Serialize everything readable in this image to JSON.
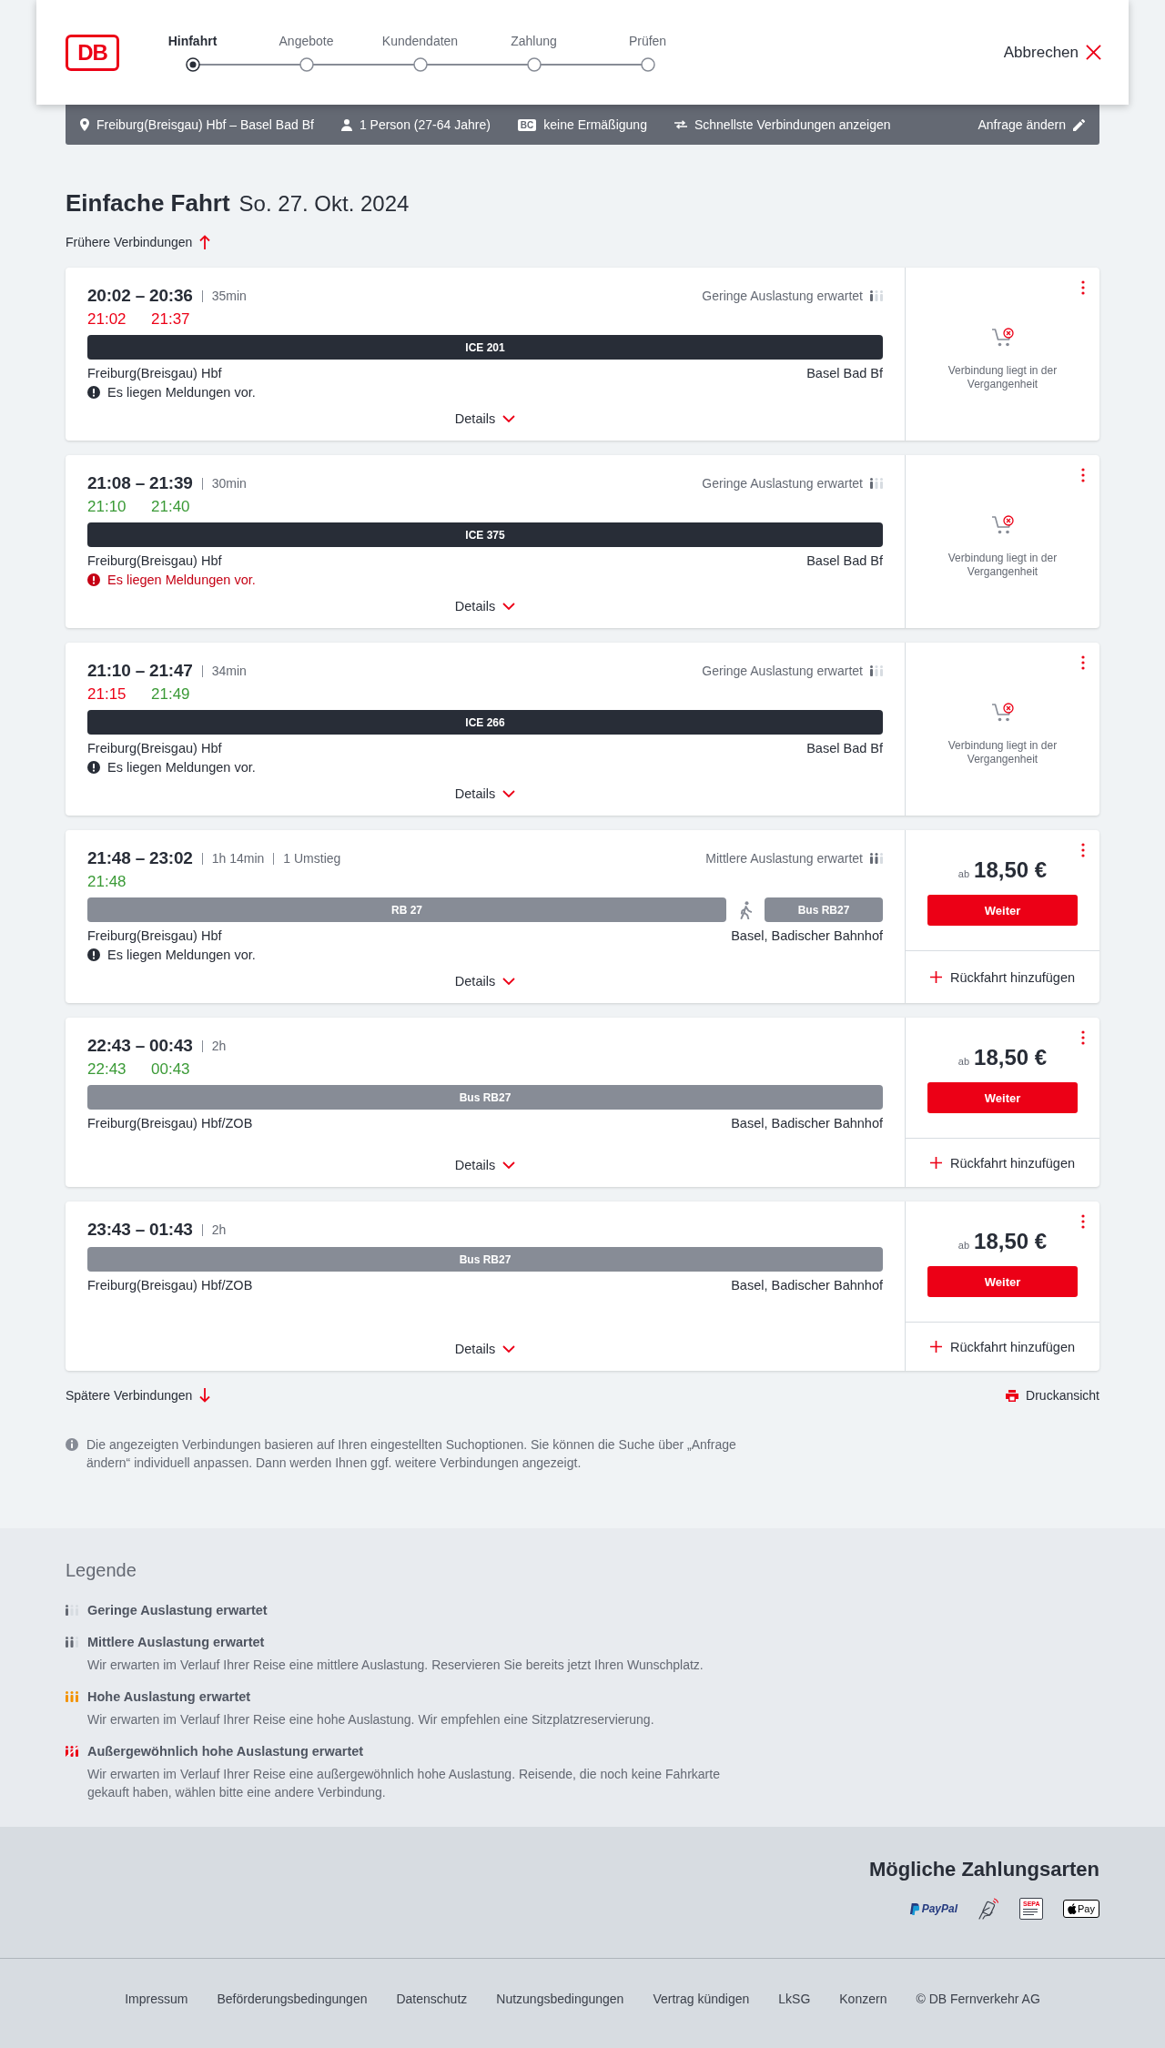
{
  "header": {
    "logo": "DB",
    "steps": [
      {
        "label": "Hinfahrt",
        "selected": true
      },
      {
        "label": "Angebote",
        "selected": false
      },
      {
        "label": "Kundendaten",
        "selected": false
      },
      {
        "label": "Zahlung",
        "selected": false
      },
      {
        "label": "Prüfen",
        "selected": false
      }
    ],
    "cancel": "Abbrechen"
  },
  "search_summary": {
    "route": "Freiburg(Breisgau) Hbf – Basel Bad Bf",
    "passengers": "1 Person (27-64 Jahre)",
    "discount_badge": "BC",
    "discount": "keine Ermäßigung",
    "option": "Schnellste Verbindungen anzeigen",
    "edit": "Anfrage ändern"
  },
  "heading": {
    "trip_type": "Einfache Fahrt",
    "date": "So. 27. Okt. 2024"
  },
  "earlier": "Frühere Verbindungen",
  "connections": [
    {
      "times": "20:02 – 20:36",
      "duration": "35min",
      "realtime": [
        {
          "time": "21:02",
          "on_time": false
        },
        {
          "time": "21:37",
          "on_time": false
        }
      ],
      "occupancy": {
        "kind": "low",
        "label": "Geringe Auslastung erwartet"
      },
      "segments": [
        {
          "kind": "ice",
          "label": "ICE 201"
        }
      ],
      "from": "Freiburg(Breisgau) Hbf",
      "to": "Basel Bad Bf",
      "message": {
        "text": "Es liegen Meldungen vor.",
        "critical": false
      },
      "details": "Details",
      "offer": {
        "kind": "past",
        "text": "Verbindung liegt in der Vergangenheit"
      }
    },
    {
      "times": "21:08 – 21:39",
      "duration": "30min",
      "realtime": [
        {
          "time": "21:10",
          "on_time": true
        },
        {
          "time": "21:40",
          "on_time": true
        }
      ],
      "occupancy": {
        "kind": "low",
        "label": "Geringe Auslastung erwartet"
      },
      "segments": [
        {
          "kind": "ice",
          "label": "ICE 375"
        }
      ],
      "from": "Freiburg(Breisgau) Hbf",
      "to": "Basel Bad Bf",
      "message": {
        "text": "Es liegen Meldungen vor.",
        "critical": true
      },
      "details": "Details",
      "offer": {
        "kind": "past",
        "text": "Verbindung liegt in der Vergangenheit"
      }
    },
    {
      "times": "21:10 – 21:47",
      "duration": "34min",
      "realtime": [
        {
          "time": "21:15",
          "on_time": false
        },
        {
          "time": "21:49",
          "on_time": true
        }
      ],
      "occupancy": {
        "kind": "low",
        "label": "Geringe Auslastung erwartet"
      },
      "segments": [
        {
          "kind": "ice",
          "label": "ICE 266"
        }
      ],
      "from": "Freiburg(Breisgau) Hbf",
      "to": "Basel Bad Bf",
      "message": {
        "text": "Es liegen Meldungen vor.",
        "critical": false
      },
      "details": "Details",
      "offer": {
        "kind": "past",
        "text": "Verbindung liegt in der Vergangenheit"
      }
    },
    {
      "times": "21:48 – 23:02",
      "duration": "1h 14min",
      "transfers": "1 Umstieg",
      "realtime": [
        {
          "time": "21:48",
          "on_time": true
        }
      ],
      "occupancy": {
        "kind": "medium",
        "label": "Mittlere Auslastung erwartet"
      },
      "segments": [
        {
          "kind": "regional",
          "label": "RB 27"
        },
        {
          "kind": "walk"
        },
        {
          "kind": "bus",
          "label": "Bus RB27"
        }
      ],
      "from": "Freiburg(Breisgau) Hbf",
      "to": "Basel, Badischer Bahnhof",
      "message": {
        "text": "Es liegen Meldungen vor.",
        "critical": false
      },
      "details": "Details",
      "offer": {
        "kind": "price",
        "prefix": "ab",
        "price": "18,50 €",
        "button": "Weiter",
        "return_trip": "Rückfahrt hinzufügen"
      }
    },
    {
      "times": "22:43 – 00:43",
      "duration": "2h",
      "realtime": [
        {
          "time": "22:43",
          "on_time": true
        },
        {
          "time": "00:43",
          "on_time": true
        }
      ],
      "segments": [
        {
          "kind": "bus",
          "label": "Bus RB27"
        }
      ],
      "from": "Freiburg(Breisgau) Hbf/ZOB",
      "to": "Basel, Badischer Bahnhof",
      "details": "Details",
      "offer": {
        "kind": "price",
        "prefix": "ab",
        "price": "18,50 €",
        "button": "Weiter",
        "return_trip": "Rückfahrt hinzufügen"
      }
    },
    {
      "times": "23:43 – 01:43",
      "duration": "2h",
      "segments": [
        {
          "kind": "bus",
          "label": "Bus RB27"
        }
      ],
      "from": "Freiburg(Breisgau) Hbf/ZOB",
      "to": "Basel, Badischer Bahnhof",
      "details": "Details",
      "offer": {
        "kind": "price",
        "prefix": "ab",
        "price": "18,50 €",
        "button": "Weiter",
        "return_trip": "Rückfahrt hinzufügen"
      }
    }
  ],
  "later": "Spätere Verbindungen",
  "print": "Druckansicht",
  "note": "Die angezeigten Verbindungen basieren auf Ihren eingestellten Suchoptionen. Sie können die Suche über „Anfrage ändern“ individuell anpassen. Dann werden Ihnen ggf. weitere Verbindungen angezeigt.",
  "legend": {
    "title": "Legende",
    "items": [
      {
        "kind": "low",
        "label": "Geringe Auslastung erwartet"
      },
      {
        "kind": "medium",
        "label": "Mittlere Auslastung erwartet",
        "description": "Wir erwarten im Verlauf Ihrer Reise eine mittlere Auslastung. Reservieren Sie bereits jetzt Ihren Wunschplatz."
      },
      {
        "kind": "high",
        "label": "Hohe Auslastung erwartet",
        "description": "Wir erwarten im Verlauf Ihrer Reise eine hohe Auslastung. Wir empfehlen eine Sitzplatzreservierung."
      },
      {
        "kind": "extreme",
        "label": "Außergewöhnlich hohe Auslastung erwartet",
        "description": "Wir erwarten im Verlauf Ihrer Reise eine außergewöhnlich hohe Auslastung. Reisende, die noch keine Fahrkarte gekauft haben, wählen bitte eine andere Verbindung."
      }
    ]
  },
  "payment": {
    "title": "Mögliche Zahlungsarten",
    "methods": [
      {
        "kind": "paypal",
        "label": "PayPal"
      },
      {
        "kind": "contactless"
      },
      {
        "kind": "sepa",
        "label": "SEPA"
      },
      {
        "kind": "applepay",
        "label": "Pay"
      }
    ]
  },
  "footer": {
    "links": [
      "Impressum",
      "Beförderungsbedingungen",
      "Datenschutz",
      "Nutzungsbedingungen",
      "Vertrag kündigen",
      "LkSG",
      "Konzern",
      "© DB Fernverkehr AG"
    ]
  }
}
